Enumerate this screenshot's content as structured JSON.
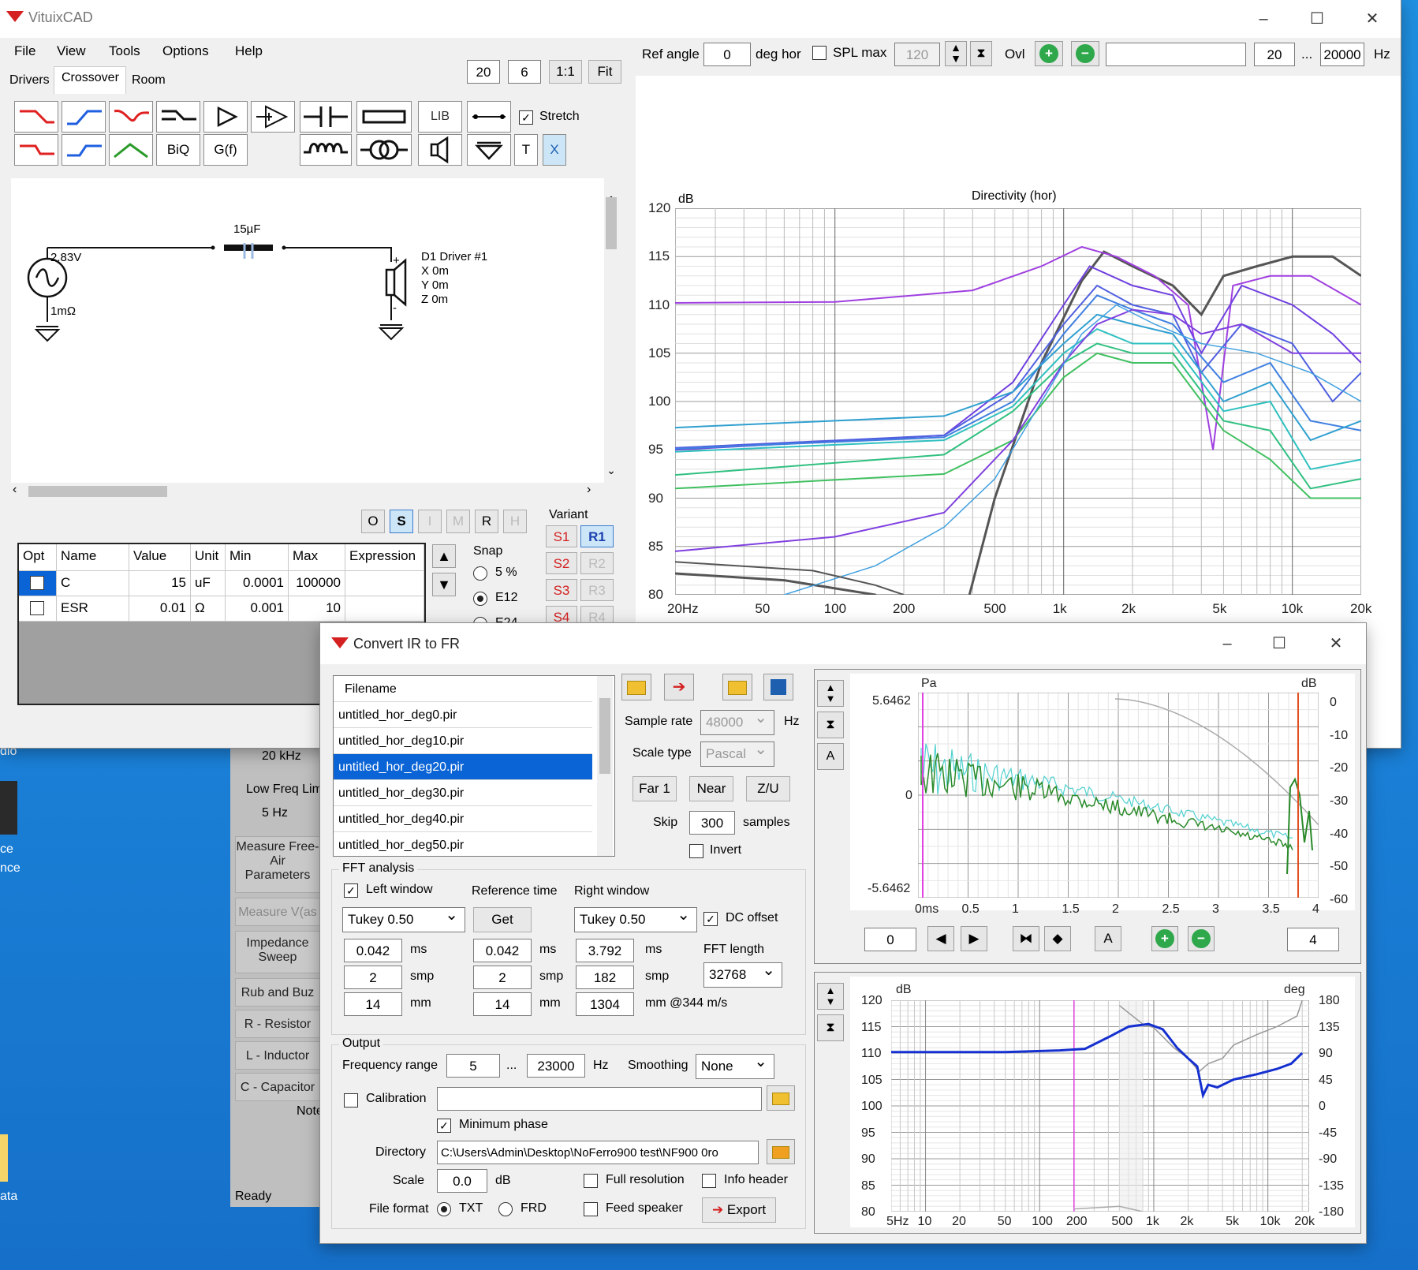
{
  "app": {
    "title": "VituixCAD"
  },
  "menu": [
    "File",
    "View",
    "Tools",
    "Options",
    "Help"
  ],
  "tabs": [
    "Drivers",
    "Crossover",
    "Room"
  ],
  "zoom": {
    "a": "20",
    "b": "6",
    "one": "1:1",
    "fit": "Fit"
  },
  "top_toolbar": {
    "ref_angle_label": "Ref angle",
    "ref_angle": "0",
    "deg_hor": "deg hor",
    "spl_max_label": "SPL max",
    "spl_max": "120",
    "ovl": "Ovl",
    "freq_from": "20",
    "dots": "...",
    "freq_to": "20000",
    "hz": "Hz"
  },
  "part_buttons": {
    "biq": "BiQ",
    "gf": "G(f)",
    "lib": "LIB",
    "t": "T",
    "x": "X",
    "stretch": "Stretch"
  },
  "schematic": {
    "cap_value": "15µF",
    "source_voltage": "2.83V",
    "source_res": "1mΩ",
    "driver_name": "D1 Driver #1",
    "x": "X 0m",
    "y": "Y 0m",
    "z": "Z 0m",
    "plus": "+",
    "minus": "-"
  },
  "mode_buttons": [
    "O",
    "S",
    "I",
    "M",
    "R",
    "H"
  ],
  "param_table": {
    "headers": [
      "Opt",
      "Name",
      "Value",
      "Unit",
      "Min",
      "Max",
      "Expression"
    ],
    "rows": [
      {
        "name": "C",
        "value": "15",
        "unit": "uF",
        "min": "0.0001",
        "max": "100000",
        "expr": ""
      },
      {
        "name": "ESR",
        "value": "0.01",
        "unit": "Ω",
        "min": "0.001",
        "max": "10",
        "expr": ""
      }
    ]
  },
  "snap": {
    "label": "Snap",
    "opt1": "5 %",
    "opt2": "E12",
    "opt3": "E24"
  },
  "variant": {
    "label": "Variant",
    "s": [
      "S1",
      "S2",
      "S3",
      "S4"
    ],
    "r": [
      "R1",
      "R2",
      "R3",
      "R4"
    ]
  },
  "side_panel": {
    "freq20k": "20 kHz",
    "low_freq_lim": "Low Freq Lim",
    "freq5": "5 Hz",
    "measure_free_air": "Measure Free-Air Parameters",
    "measure_v": "Measure V(as",
    "impedance_sweep": "Impedance Sweep",
    "rub_buzz": "Rub and Buz",
    "r_resistor": "R - Resistor",
    "l_inductor": "L - Inductor",
    "c_capacitor": "C - Capacitor",
    "note": "Note",
    "status": "Ready"
  },
  "desktop": {
    "i1": "dio",
    "i2": "ce",
    "i3": "nce",
    "i4": "ata"
  },
  "directivity_chart": {
    "title": "Directivity (hor)",
    "ylabel": "dB",
    "ytick": [
      "120",
      "115",
      "110",
      "105",
      "100",
      "95",
      "90",
      "85",
      "80"
    ],
    "xtick": [
      "20Hz",
      "50",
      "100",
      "200",
      "500",
      "1k",
      "2k",
      "5k",
      "10k",
      "20k"
    ]
  },
  "dialog": {
    "title": "Convert IR to FR",
    "file_header": "Filename",
    "files": [
      "untitled_hor_deg0.pir",
      "untitled_hor_deg10.pir",
      "untitled_hor_deg20.pir",
      "untitled_hor_deg30.pir",
      "untitled_hor_deg40.pir",
      "untitled_hor_deg50.pir"
    ],
    "sample_rate_label": "Sample rate",
    "sample_rate": "48000",
    "hz": "Hz",
    "scale_type_label": "Scale type",
    "scale_type": "Pascal",
    "far1": "Far 1",
    "near": "Near",
    "zu": "Z/U",
    "skip_label": "Skip",
    "skip": "300",
    "samples": "samples",
    "invert": "Invert",
    "fft_label": "FFT analysis",
    "left_window": "Left window",
    "ref_time": "Reference time",
    "right_window": "Right window",
    "left_type": "Tukey 0.50",
    "get": "Get",
    "right_type": "Tukey 0.50",
    "dc_offset": "DC offset",
    "left_ms": "0.042",
    "left_smp": "2",
    "left_mm": "14",
    "ref_ms": "0.042",
    "ref_smp": "2",
    "ref_mm": "14",
    "right_ms": "3.792",
    "right_smp": "182",
    "right_mm": "1304",
    "ms": "ms",
    "smp": "smp",
    "mm": "mm",
    "mm344": "mm @344 m/s",
    "fft_length_label": "FFT length",
    "fft_length": "32768",
    "output_label": "Output",
    "freq_range_label": "Frequency range",
    "freq_from": "5",
    "dots": "...",
    "freq_to": "23000",
    "smoothing_label": "Smoothing",
    "smoothing": "None",
    "calibration": "Calibration",
    "minimum_phase": "Minimum phase",
    "directory_label": "Directory",
    "directory": "C:\\Users\\Admin\\Desktop\\NoFerro900 test\\NF900 0ro",
    "scale_label": "Scale",
    "scale": "0.0",
    "db": "dB",
    "full_resolution": "Full resolution",
    "info_header": "Info header",
    "file_format_label": "File format",
    "txt": "TXT",
    "frd": "FRD",
    "feed_speaker": "Feed speaker",
    "export": "Export",
    "ir_chart": {
      "ytop": "5.6462",
      "ymid": "0",
      "ybot": "-5.6462",
      "unit_l": "Pa",
      "unit_r": "dB",
      "rticks": [
        "0",
        "-10",
        "-20",
        "-30",
        "-40",
        "-50",
        "-60"
      ],
      "xticks": [
        "0ms",
        "0.5",
        "1",
        "1.5",
        "2",
        "2.5",
        "3",
        "3.5",
        "4"
      ]
    },
    "ir_nav": {
      "start": "0",
      "end": "4",
      "a": "A"
    },
    "fr_chart": {
      "unit_l": "dB",
      "unit_r": "deg",
      "lticks": [
        "120",
        "115",
        "110",
        "105",
        "100",
        "95",
        "90",
        "85",
        "80"
      ],
      "rticks": [
        "180",
        "135",
        "90",
        "45",
        "0",
        "-45",
        "-90",
        "-135",
        "-180"
      ],
      "xticks": [
        "5Hz",
        "10",
        "20",
        "50",
        "100",
        "200",
        "500",
        "1k",
        "2k",
        "5k",
        "10k",
        "20k"
      ]
    }
  }
}
